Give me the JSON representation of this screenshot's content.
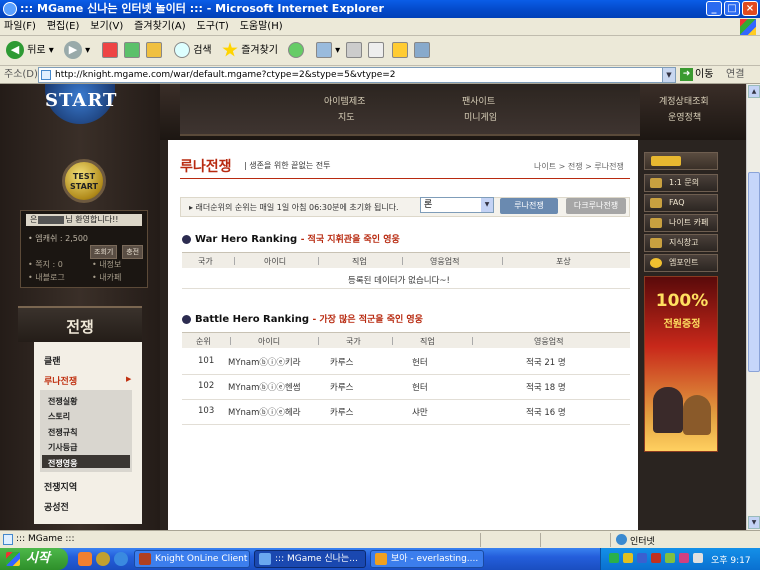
{
  "window": {
    "title": "::: MGame 신나는 인터넷 놀이터 ::: - Microsoft Internet Explorer",
    "min": "_",
    "max": "□",
    "close": "×"
  },
  "menu": [
    "파일(F)",
    "편집(E)",
    "보기(V)",
    "즐겨찾기(A)",
    "도구(T)",
    "도움말(H)"
  ],
  "toolbar": {
    "back": "뒤로",
    "search": "검색",
    "favorites": "즐겨찾기"
  },
  "address": {
    "label": "주소(D)",
    "url": "http://knight.mgame.com/war/default.mgame?ctype=2&stype=5&vtype=2",
    "go": "이동",
    "links": "연결"
  },
  "header": {
    "start": "START",
    "nav": [
      "아이템제조",
      "지도",
      "팬사이트",
      "미니게임",
      "계정상태조회",
      "운영정책"
    ]
  },
  "left": {
    "test_start": [
      "TEST",
      "START"
    ],
    "welcome_prefix": "은",
    "welcome_suffix": "님 환영합니다!!",
    "mileage": "• 엠캐쉬 : 2,500",
    "btns": [
      "조회기",
      "충전"
    ],
    "links": [
      "• 쪽지 : 0",
      "• 내정보",
      "• 내블로그",
      "• 내카페"
    ],
    "war_title": "전쟁",
    "war_menu": [
      "클랜",
      "루나전쟁",
      "전쟁지역",
      "공성전"
    ],
    "war_sub": [
      "전쟁실황",
      "스토리",
      "전쟁규칙",
      "기사등급",
      "전쟁영웅"
    ]
  },
  "content": {
    "title": "루나전쟁",
    "subtitle": "| 생존을 위한 끝없는 전투",
    "breadcrumb": "나이트 > 전쟁 > 루나전쟁",
    "notice": "▸ 래더순위의 순위는 매일 1일 아침 06:30분에 초기화 됩니다.",
    "server": "론",
    "btn_luna": "루나전쟁",
    "btn_dark": "다크루나전쟁",
    "war_hero": {
      "title": "War Hero Ranking",
      "sub": "- 적국 지휘관을 죽인 영웅",
      "cols": [
        "국가",
        "아이디",
        "직업",
        "영웅업적",
        "포상"
      ],
      "empty": "등록된 데이터가 없습니다~!"
    },
    "battle_hero": {
      "title": "Battle Hero  Ranking",
      "sub": "- 가장 많은 적군을 죽인 영웅",
      "cols": [
        "순위",
        "아이디",
        "국가",
        "직업",
        "영웅업적"
      ],
      "rows": [
        {
          "rank": "101",
          "id": "MYnamⓑⓘⓔ키라",
          "nation": "카루스",
          "job": "헌터",
          "score": "적국 21 명"
        },
        {
          "rank": "102",
          "id": "MYnamⓑⓘⓔ헨썸",
          "nation": "카루스",
          "job": "헌터",
          "score": "적국 18 명"
        },
        {
          "rank": "103",
          "id": "MYnamⓑⓘⓔ헤라",
          "nation": "카루스",
          "job": "샤만",
          "score": "적국 16 명"
        }
      ]
    }
  },
  "right": {
    "buttons": [
      "1:1 문의",
      "FAQ",
      "나이트 카페",
      "지식창고",
      "엠포인트"
    ],
    "banner": [
      "100%",
      "전원증정"
    ]
  },
  "status": {
    "left": "::: MGame :::",
    "zone": "인터넷"
  },
  "taskbar": {
    "start": "시작",
    "tasks": [
      "Knight OnLine Client",
      "::: MGame 신나는...",
      "보아 - everlasting...."
    ],
    "clock": "오후 9:17"
  }
}
